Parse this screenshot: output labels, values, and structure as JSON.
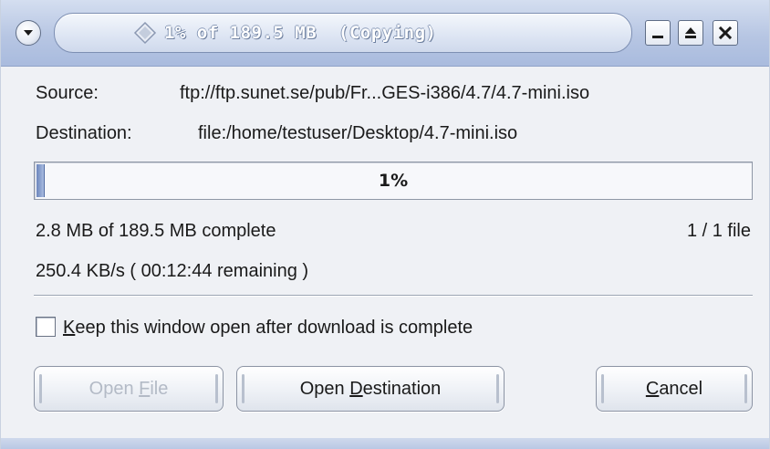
{
  "window": {
    "title": "1% of 189.5 MB  (Copying)",
    "menu_icon": "chevron-down-icon",
    "title_icon": "diamond-icon",
    "controls": {
      "minimize_icon": "minimize-icon",
      "maximize_icon": "maximize-icon",
      "close_icon": "close-icon"
    },
    "accent_color": "#b7c6e3"
  },
  "transfer": {
    "source_label": "Source:",
    "source_value": "ftp://ftp.sunet.se/pub/Fr...GES-i386/4.7/4.7-mini.iso",
    "destination_label": "Destination:",
    "destination_value": "file:/home/testuser/Desktop/4.7-mini.iso",
    "progress_percent": 1,
    "progress_text": "1%",
    "progress_color": "#6c86bd",
    "size_status": "2.8 MB of 189.5 MB complete",
    "file_count": "1 / 1 file",
    "rate_status": "250.4 KB/s ( 00:12:44 remaining )"
  },
  "options": {
    "keep_open_mnemonic": "K",
    "keep_open_rest": "eep this window open after download is complete",
    "keep_open_checked": false
  },
  "buttons": {
    "open_file_prefix": "Open ",
    "open_file_mnemonic": "F",
    "open_file_rest": "ile",
    "open_file_enabled": false,
    "open_destination_prefix": "Open ",
    "open_destination_mnemonic": "D",
    "open_destination_rest": "estination",
    "cancel_mnemonic": "C",
    "cancel_rest": "ancel"
  }
}
